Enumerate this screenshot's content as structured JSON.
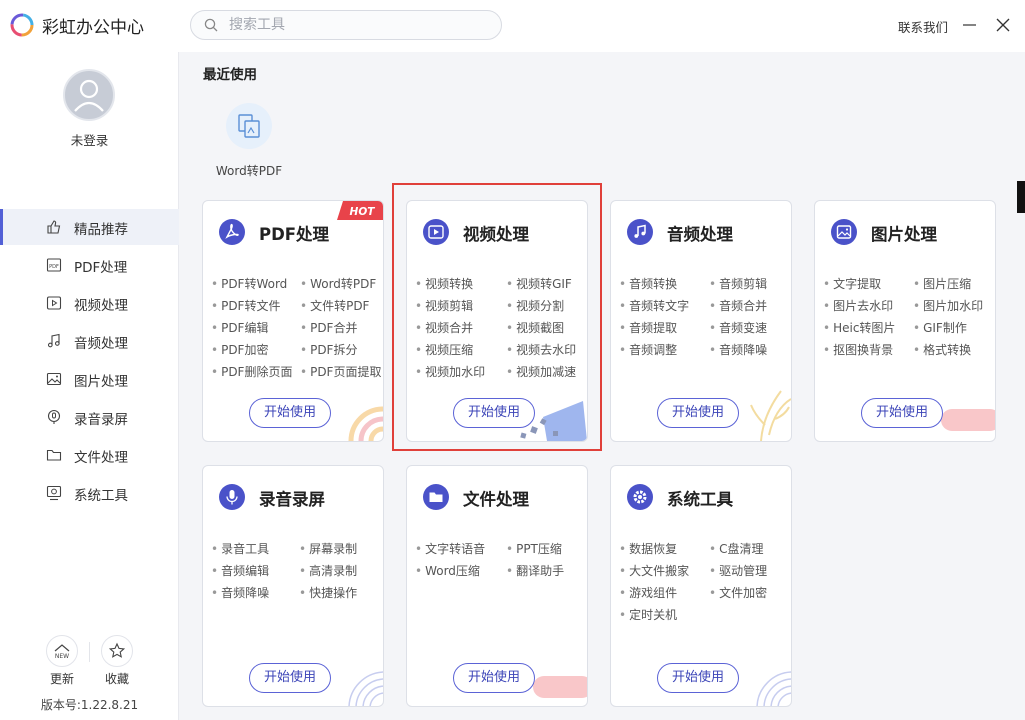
{
  "app": {
    "title": "彩虹办公中心",
    "contact": "联系我们"
  },
  "search": {
    "placeholder": "搜索工具"
  },
  "user": {
    "status": "未登录"
  },
  "nav": [
    {
      "label": "精品推荐",
      "icon": "thumbs-up-icon",
      "active": true
    },
    {
      "label": "PDF处理",
      "icon": "pdf-icon"
    },
    {
      "label": "视频处理",
      "icon": "video-icon"
    },
    {
      "label": "音频处理",
      "icon": "music-icon"
    },
    {
      "label": "图片处理",
      "icon": "image-icon"
    },
    {
      "label": "录音录屏",
      "icon": "record-icon"
    },
    {
      "label": "文件处理",
      "icon": "folder-icon"
    },
    {
      "label": "系统工具",
      "icon": "system-tool-icon"
    }
  ],
  "footer": {
    "update_label": "更新",
    "favorite_label": "收藏",
    "version": "版本号:1.22.8.21"
  },
  "recent": {
    "title": "最近使用",
    "items": [
      {
        "label": "Word转PDF",
        "icon": "word-to-pdf-icon"
      }
    ]
  },
  "badges": {
    "hot": "HOT"
  },
  "cards": [
    {
      "title": "PDF处理",
      "icon": "pdf-icon",
      "features": [
        "PDF转Word",
        "Word转PDF",
        "PDF转文件",
        "文件转PDF",
        "PDF编辑",
        "PDF合并",
        "PDF加密",
        "PDF拆分",
        "PDF删除页面",
        "PDF页面提取"
      ],
      "button": "开始使用"
    },
    {
      "title": "视频处理",
      "icon": "video-play-icon",
      "features": [
        "视频转换",
        "视频转GIF",
        "视频剪辑",
        "视频分割",
        "视频合并",
        "视频截图",
        "视频压缩",
        "视频去水印",
        "视频加水印",
        "视频加减速"
      ],
      "button": "开始使用"
    },
    {
      "title": "音频处理",
      "icon": "music-note-icon",
      "features": [
        "音频转换",
        "音频剪辑",
        "音频转文字",
        "音频合并",
        "音频提取",
        "音频变速",
        "音频调整",
        "音频降噪"
      ],
      "button": "开始使用"
    },
    {
      "title": "图片处理",
      "icon": "image-icon",
      "features": [
        "文字提取",
        "图片压缩",
        "图片去水印",
        "图片加水印",
        "Heic转图片",
        "GIF制作",
        "抠图换背景",
        "格式转换"
      ],
      "button": "开始使用"
    },
    {
      "title": "录音录屏",
      "icon": "microphone-icon",
      "features": [
        "录音工具",
        "屏幕录制",
        "音频编辑",
        "高清录制",
        "音频降噪",
        "快捷操作"
      ],
      "button": "开始使用"
    },
    {
      "title": "文件处理",
      "icon": "folder-icon",
      "features": [
        "文字转语音",
        "PPT压缩",
        "Word压缩",
        "翻译助手"
      ],
      "button": "开始使用"
    },
    {
      "title": "系统工具",
      "icon": "gear-icon",
      "features": [
        "数据恢复",
        "C盘清理",
        "大文件搬家",
        "驱动管理",
        "游戏组件",
        "文件加密",
        "定时关机"
      ],
      "button": "开始使用"
    }
  ],
  "colors": {
    "accent": "#4a52c9",
    "highlight": "#e0403a",
    "hot": "#e8434a"
  }
}
